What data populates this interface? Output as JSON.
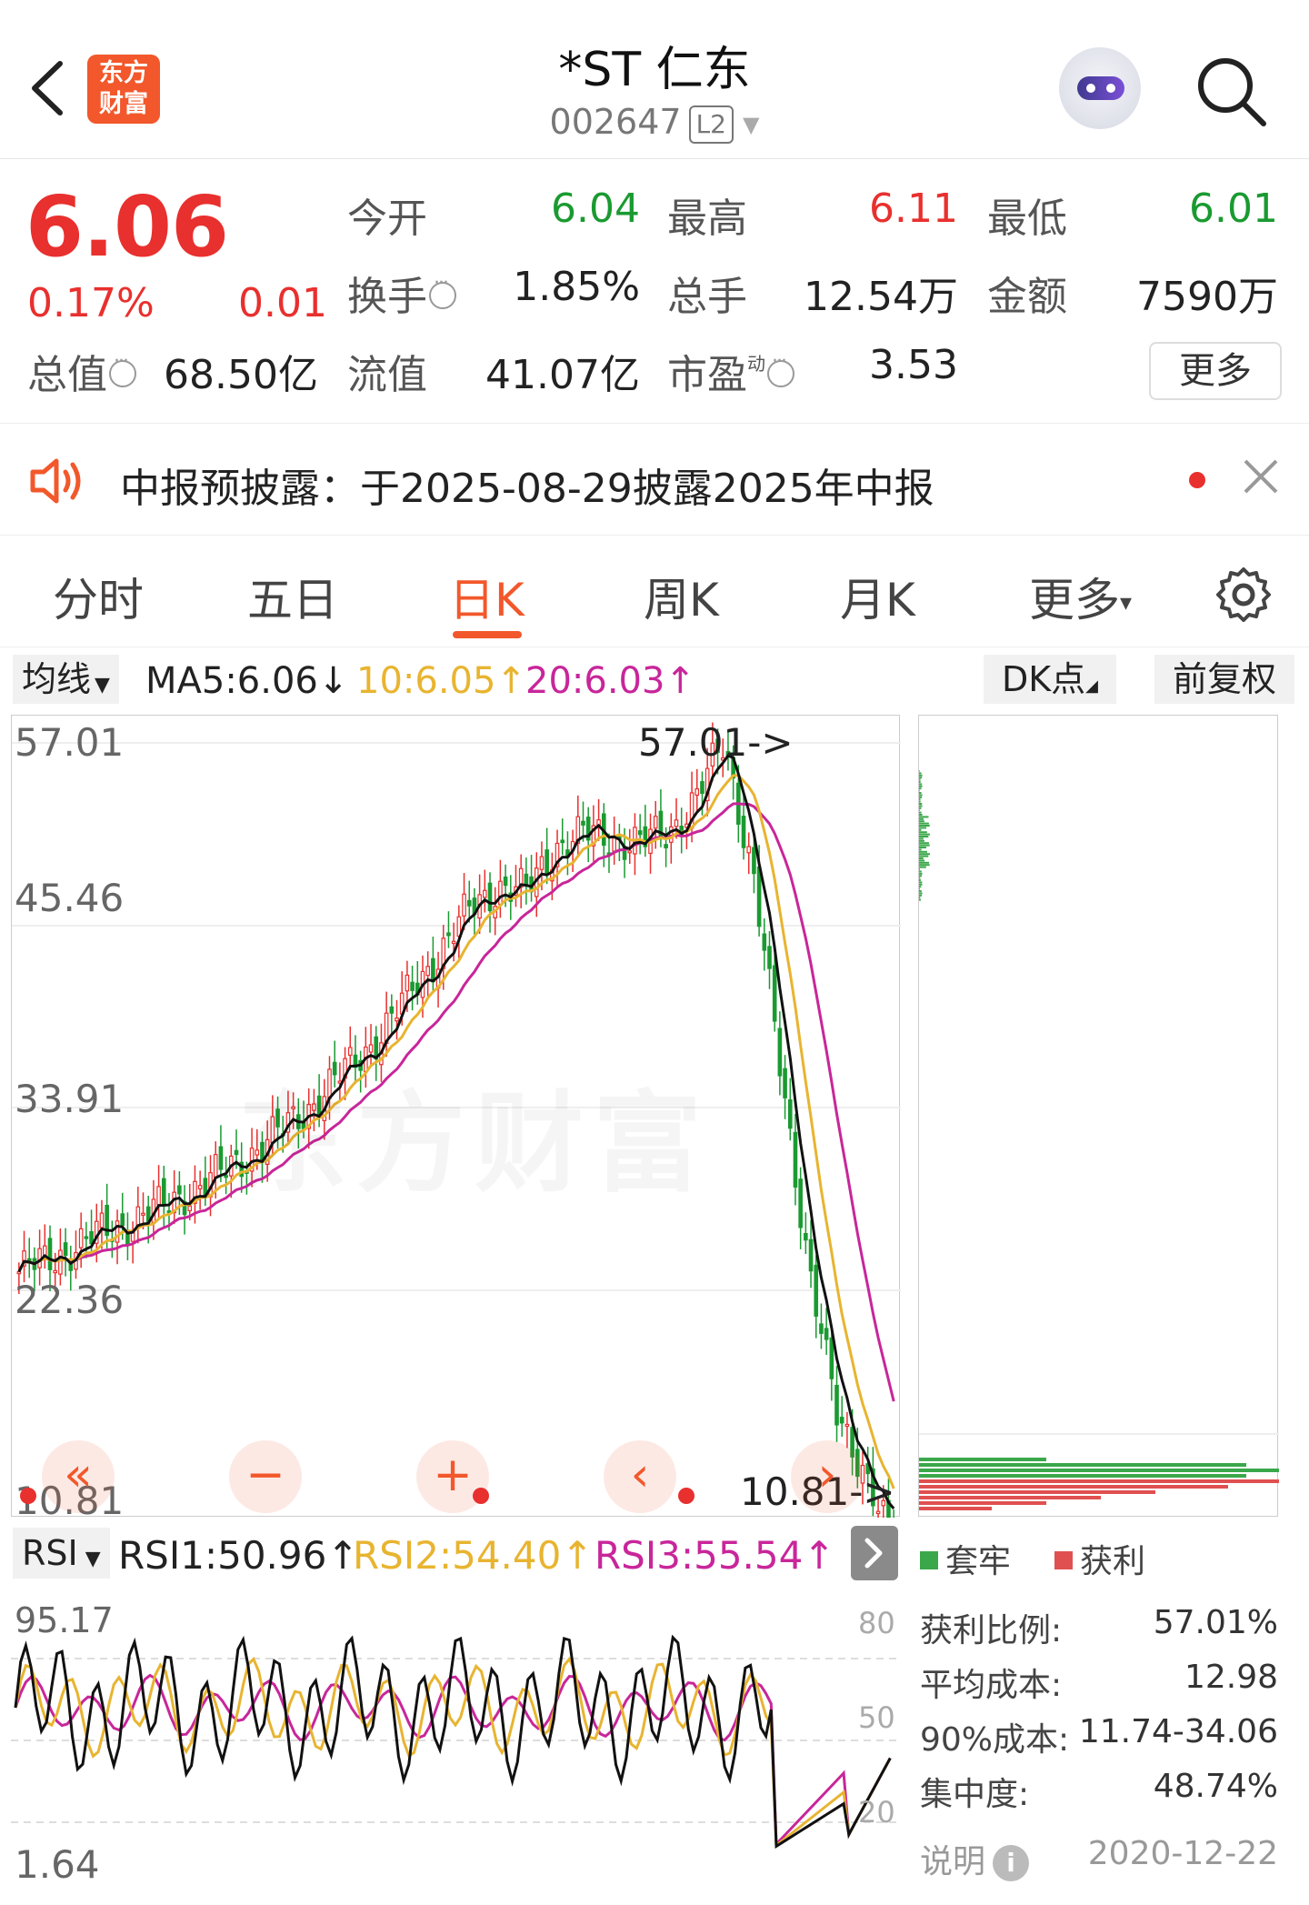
{
  "header": {
    "logo_text_line1": "东方",
    "logo_text_line2": "财富",
    "stock_name": "*ST 仁东",
    "stock_code": "002647",
    "level_badge": "L2",
    "icons": {
      "back": "back-arrow-icon",
      "search": "search-icon",
      "assistant": "robot-assistant-icon"
    }
  },
  "quote": {
    "price": "6.06",
    "change_pct": "0.17%",
    "change_val": "0.01",
    "price_color": "#e8302e",
    "fields": {
      "open_label": "今开",
      "open_value": "6.04",
      "high_label": "最高",
      "high_value": "6.11",
      "low_label": "最低",
      "low_value": "6.01",
      "turnover_label": "换手",
      "turnover_value": "1.85%",
      "volume_label": "总手",
      "volume_value": "12.54万",
      "amount_label": "金额",
      "amount_value": "7590万",
      "mktcap_label": "总值",
      "mktcap_value": "68.50亿",
      "float_label": "流值",
      "float_value": "41.07亿",
      "pe_label": "市盈",
      "pe_sup": "动",
      "pe_value": "3.53"
    },
    "more_label": "更多"
  },
  "notice": {
    "text": "中报预披露：于2025-08-29披露2025年中报",
    "icon": "speaker-icon"
  },
  "tabs": {
    "items": [
      "分时",
      "五日",
      "日K",
      "周K",
      "月K",
      "更多"
    ],
    "active": "日K",
    "more_caret": "▾"
  },
  "ma_bar": {
    "selector": "均线",
    "ma5": "MA5:6.06",
    "ma10": "10:6.05",
    "ma20": "20:6.03",
    "ma5_arrow": "↓",
    "ma10_arrow": "↑",
    "ma20_arrow": "↑",
    "dk_label": "DK点",
    "adjust_label": "前复权"
  },
  "colors": {
    "accent": "#f2582b",
    "up": "#e8302e",
    "down": "#1a9a31",
    "ma5": "#111111",
    "ma10": "#e8b430",
    "ma20": "#c8269a"
  },
  "chart_data": [
    {
      "type": "candlestick",
      "y_tick_labels": [
        "57.01",
        "45.46",
        "33.91",
        "22.36",
        "10.81"
      ],
      "ylim": [
        10.81,
        57.01
      ],
      "annotations": [
        "57.01->",
        "10.81->"
      ],
      "watermark": "东方财富",
      "series": [
        {
          "name": "MA5",
          "last": 6.06
        },
        {
          "name": "MA10",
          "last": 6.05
        },
        {
          "name": "MA20",
          "last": 6.03
        }
      ],
      "close_trend": [
        23.5,
        24.2,
        25.1,
        26.0,
        26.8,
        27.5,
        28.6,
        29.5,
        30.8,
        32.0,
        33.5,
        35.2,
        37.0,
        39.0,
        41.5,
        44.0,
        46.5,
        48.0,
        47.5,
        50.5,
        51.2,
        51.0,
        50.6,
        51.4,
        53.5,
        57.0,
        49.0,
        36.0,
        24.0,
        14.0,
        11.0,
        6.06
      ]
    },
    {
      "type": "line",
      "title": "RSI",
      "y_tick_labels": [
        "80",
        "50",
        "20"
      ],
      "side_labels": [
        "95.17",
        "1.64"
      ],
      "series": [
        {
          "name": "RSI1:50.96",
          "value": 50.96,
          "arrow": "↑"
        },
        {
          "name": "RSI2:54.40",
          "value": 54.4,
          "arrow": "↑"
        },
        {
          "name": "RSI3:55.54",
          "value": 55.54,
          "arrow": "↑"
        }
      ]
    }
  ],
  "rsi_bar": {
    "selector": "RSI",
    "rsi1": "RSI1:50.96",
    "rsi2": "RSI2:54.40",
    "rsi3": "RSI3:55.54",
    "arrow": "↑"
  },
  "chip": {
    "legend_trapped": "套牢",
    "legend_profit": "获利",
    "profit_ratio_label": "获利比例:",
    "profit_ratio_value": "57.01%",
    "avg_cost_label": "平均成本:",
    "avg_cost_value": "12.98",
    "cost90_label": "90%成本:",
    "cost90_value": "11.74-34.06",
    "concentration_label": "集中度:",
    "concentration_value": "48.74%",
    "explain_label": "说明",
    "date": "2020-12-22"
  }
}
